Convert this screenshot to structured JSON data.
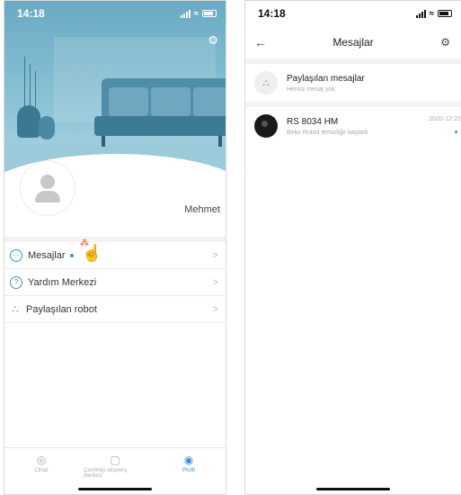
{
  "left": {
    "status_time": "14:18",
    "username": "Mehmet",
    "menu": [
      {
        "label": "Mesajlar",
        "icon": "ellipsis-icon"
      },
      {
        "label": "Yardım Merkezi",
        "icon": "help-icon"
      },
      {
        "label": "Paylaşılan robot",
        "icon": "share-icon"
      }
    ],
    "tabs": [
      {
        "label": "Cihaz",
        "icon": "device-icon"
      },
      {
        "label": "Çevrimiçi alışveriş merkezi",
        "icon": "cart-icon"
      },
      {
        "label": "Profil",
        "icon": "profile-icon",
        "active": true
      }
    ]
  },
  "right": {
    "status_time": "14:18",
    "title": "Mesajlar",
    "messages": [
      {
        "title": "Paylaşılan mesajlar",
        "subtitle": "Henüz mesaj yok",
        "icon": "share-icon"
      },
      {
        "title": "RS 8034 HM",
        "subtitle": "Beko Robot temizliğe başladı",
        "time": "2020-12-22",
        "icon": "robot-icon",
        "unread": true
      }
    ]
  },
  "colors": {
    "accent": "#3d8fd6",
    "hero": "#6aaac4"
  }
}
